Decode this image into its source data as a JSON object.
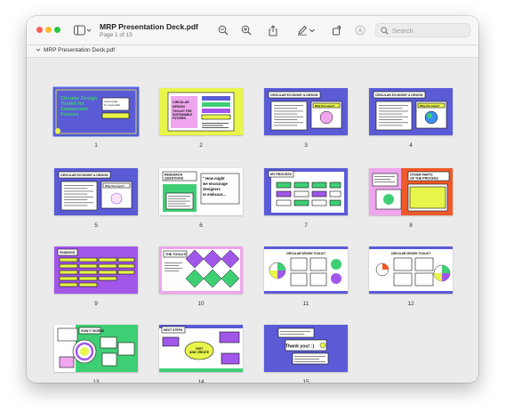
{
  "window": {
    "title": "MRP Presentation Deck.pdf",
    "subtitle": "Page 1 of 15"
  },
  "toolbar": {
    "icons": [
      "sidebar-toggle-icon",
      "zoom-out-icon",
      "zoom-in-icon",
      "share-icon",
      "markup-pen-icon",
      "chevron-down-icon",
      "rotate-icon",
      "accessibility-icon",
      "search-icon"
    ],
    "search_placeholder": "Search"
  },
  "pathbar": {
    "label": "MRP Presentation Deck.pdf"
  },
  "colors": {
    "blue": "#5b5bd6",
    "yellow": "#e8f54a",
    "green": "#3ecf74",
    "purple": "#a157ea",
    "pink": "#f0a6ee",
    "orange": "#ef5a2a"
  },
  "pages": [
    {
      "num": "1",
      "title": "Circular Design Toolkit for Sustainable Futures",
      "sub": "A pilot guide for responsible product design"
    },
    {
      "num": "2",
      "title": "CIRCULAR DESIGN TOOLKIT FOR SUSTAINABLE FUTURES"
    },
    {
      "num": "3",
      "title": "CIRCULAR ECONOMY & DESIGN",
      "sub": "Why this topic?"
    },
    {
      "num": "4",
      "title": "CIRCULAR ECONOMY & DESIGN",
      "sub": "Why this topic?"
    },
    {
      "num": "5",
      "title": "CIRCULAR ECONOMY & DESIGN",
      "sub": "Why this topic?"
    },
    {
      "num": "6",
      "title": "RESEARCH QUESTIONS",
      "sub": "\" How might we encourage designers to embrace circular design practices? \""
    },
    {
      "num": "7",
      "title": "MY PROCESS"
    },
    {
      "num": "8",
      "title": "OTHER PARTS OF THE PROCESS"
    },
    {
      "num": "9",
      "title": "FINDINGS"
    },
    {
      "num": "10",
      "title": "THE TOOLKIT"
    },
    {
      "num": "11",
      "title": "CIRCULAR DESIGN TOOLKIT"
    },
    {
      "num": "12",
      "title": "CIRCULAR DESIGN TOOLKIT"
    },
    {
      "num": "13",
      "title": "HOW IT WORKS"
    },
    {
      "num": "14",
      "title": "NEXT STEPS"
    },
    {
      "num": "15",
      "title": "Thank you! :)"
    }
  ]
}
